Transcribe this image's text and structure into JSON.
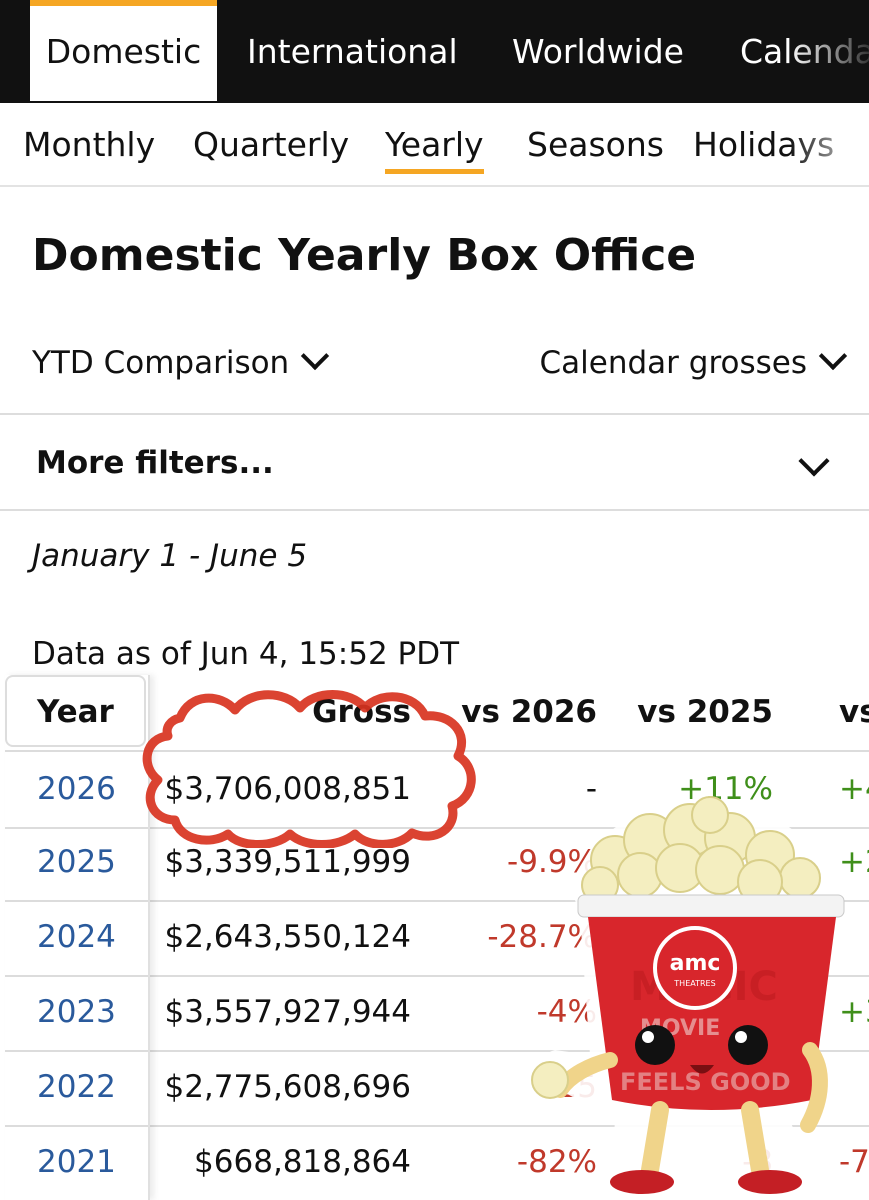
{
  "topnav": {
    "tabs": [
      {
        "label": "Domestic",
        "active": true
      },
      {
        "label": "International",
        "active": false
      },
      {
        "label": "Worldwide",
        "active": false
      },
      {
        "label": "Calenda",
        "active": false
      }
    ]
  },
  "subnav": {
    "tabs": [
      {
        "label": "Monthly",
        "active": false
      },
      {
        "label": "Quarterly",
        "active": false
      },
      {
        "label": "Yearly",
        "active": true
      },
      {
        "label": "Seasons",
        "active": false
      },
      {
        "label": "Holidays",
        "active": false
      }
    ]
  },
  "page": {
    "title": "Domestic Yearly Box Office",
    "dropdown_left": "YTD Comparison",
    "dropdown_right": "Calendar grosses",
    "more_filters": "More filters...",
    "date_range": "January 1 - June 5",
    "as_of": "Data as of Jun 4, 15:52 PDT"
  },
  "table": {
    "headers": [
      "Year",
      "Gross",
      "vs 2026",
      "vs 2025",
      "vs"
    ],
    "rows": [
      {
        "year": "2026",
        "gross": "$3,706,008,851",
        "vs2026": "-",
        "vs2025": "+11%",
        "vs2024": "+4"
      },
      {
        "year": "2025",
        "gross": "$3,339,511,999",
        "vs2026": "-9.9%",
        "vs2025": "",
        "vs2024": "+2"
      },
      {
        "year": "2024",
        "gross": "$2,643,550,124",
        "vs2026": "-28.7%",
        "vs2025": "",
        "vs2024": ""
      },
      {
        "year": "2023",
        "gross": "$3,557,927,944",
        "vs2026": "-4%",
        "vs2025": "",
        "vs2024": "+3"
      },
      {
        "year": "2022",
        "gross": "$2,775,608,696",
        "vs2026": "-25",
        "vs2025": "",
        "vs2024": ""
      },
      {
        "year": "2021",
        "gross": "$668,818,864",
        "vs2026": "-82%",
        "vs2025": "-8",
        "vs2024": "-7"
      }
    ]
  },
  "sticker": {
    "brand": "amc",
    "sub": "THEATRES",
    "cup_words": [
      "MAGIC",
      "MOVIE",
      "FEELS GOOD"
    ]
  },
  "colors": {
    "accent": "#f5a623",
    "year_link": "#2a5a9c",
    "negative": "#c0392b",
    "positive": "#3f8f1a",
    "cup_red": "#d8262c"
  }
}
